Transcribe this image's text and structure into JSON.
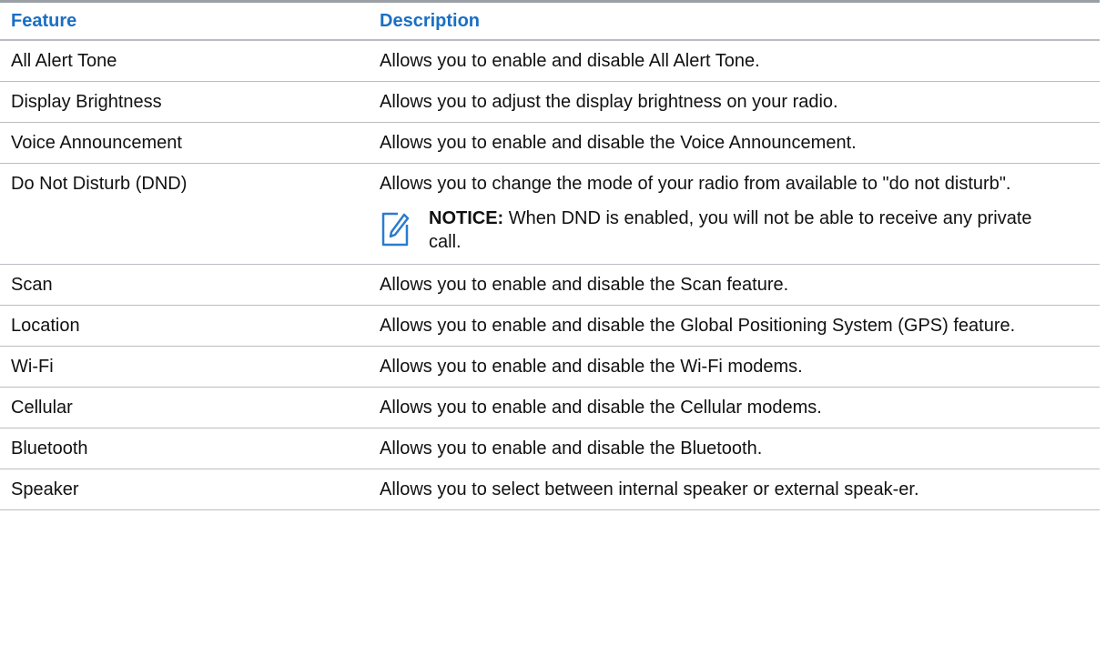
{
  "table": {
    "headers": {
      "feature": "Feature",
      "description": "Description"
    },
    "rows": [
      {
        "feature": "All Alert Tone",
        "description": "Allows you to enable and disable All Alert Tone."
      },
      {
        "feature": "Display Brightness",
        "description": "Allows you to adjust the display brightness on your radio."
      },
      {
        "feature": "Voice Announcement",
        "description": "Allows you to enable and disable the Voice Announcement."
      },
      {
        "feature": "Do Not Disturb (DND)",
        "description": "Allows you to change the mode of your radio from available to \"do not disturb\".",
        "notice": {
          "label": "NOTICE:",
          "text": "When DND is enabled, you will not be able to receive any private call.",
          "icon": "notice-pencil-icon"
        }
      },
      {
        "feature": "Scan",
        "description": "Allows you to enable and disable the Scan feature."
      },
      {
        "feature": "Location",
        "description": "Allows you to enable and disable the Global Positioning System (GPS) feature."
      },
      {
        "feature": "Wi-Fi",
        "description": "Allows you to enable and disable the Wi-Fi modems."
      },
      {
        "feature": "Cellular",
        "description": "Allows you to enable and disable the Cellular modems."
      },
      {
        "feature": "Bluetooth",
        "description": "Allows you to enable and disable the Bluetooth."
      },
      {
        "feature": "Speaker",
        "description": "Allows you to select between internal speaker or external speak-er."
      }
    ]
  },
  "colors": {
    "header_text": "#1a6fc4",
    "rule": "#b9bdc1",
    "top_rule": "#9aa0a6",
    "icon": "#2a7bd0"
  }
}
